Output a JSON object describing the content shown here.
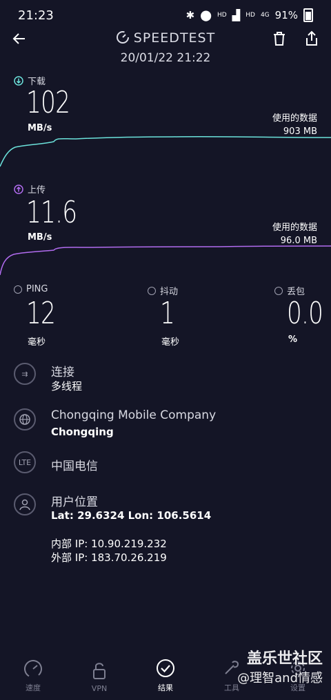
{
  "status_bar": {
    "time": "21:23",
    "hd1": "HD",
    "hd2": "HD",
    "net": "4G",
    "battery": "91%"
  },
  "header": {
    "title": "SPEEDTEST",
    "date": "20/01/22 21:22"
  },
  "download": {
    "label": "下载",
    "value": "102",
    "unit": "MB/s",
    "data_label": "使用的数据",
    "data_value": "903 MB",
    "color": "#6ce3dc"
  },
  "upload": {
    "label": "上传",
    "value": "11.6",
    "unit": "MB/s",
    "data_label": "使用的数据",
    "data_value": "96.0 MB",
    "color": "#b26cf0"
  },
  "metrics": {
    "ping": {
      "label": "PING",
      "value": "12",
      "unit": "毫秒"
    },
    "jitter": {
      "label": "抖动",
      "value": "1",
      "unit": "毫秒"
    },
    "loss": {
      "label": "丢包",
      "value": "0.0",
      "unit": "%"
    }
  },
  "info": {
    "connection": {
      "title": "连接",
      "value": "多线程"
    },
    "server": {
      "title": "Chongqing Mobile Company",
      "value": "Chongqing"
    },
    "carrier": {
      "icon_text": "LTE",
      "title": "中国电信"
    },
    "location": {
      "title": "用户位置",
      "value": "Lat: 29.6324 Lon: 106.5614"
    },
    "internal_ip": "内部 IP: 10.90.219.232",
    "external_ip": "外部 IP: 183.70.26.219"
  },
  "nav": {
    "speed": "速度",
    "vpn": "VPN",
    "results": "结果",
    "tools": "工具",
    "settings": "设置"
  },
  "watermark": {
    "line1": "盖乐世社区",
    "line2": "@理智and情感"
  }
}
